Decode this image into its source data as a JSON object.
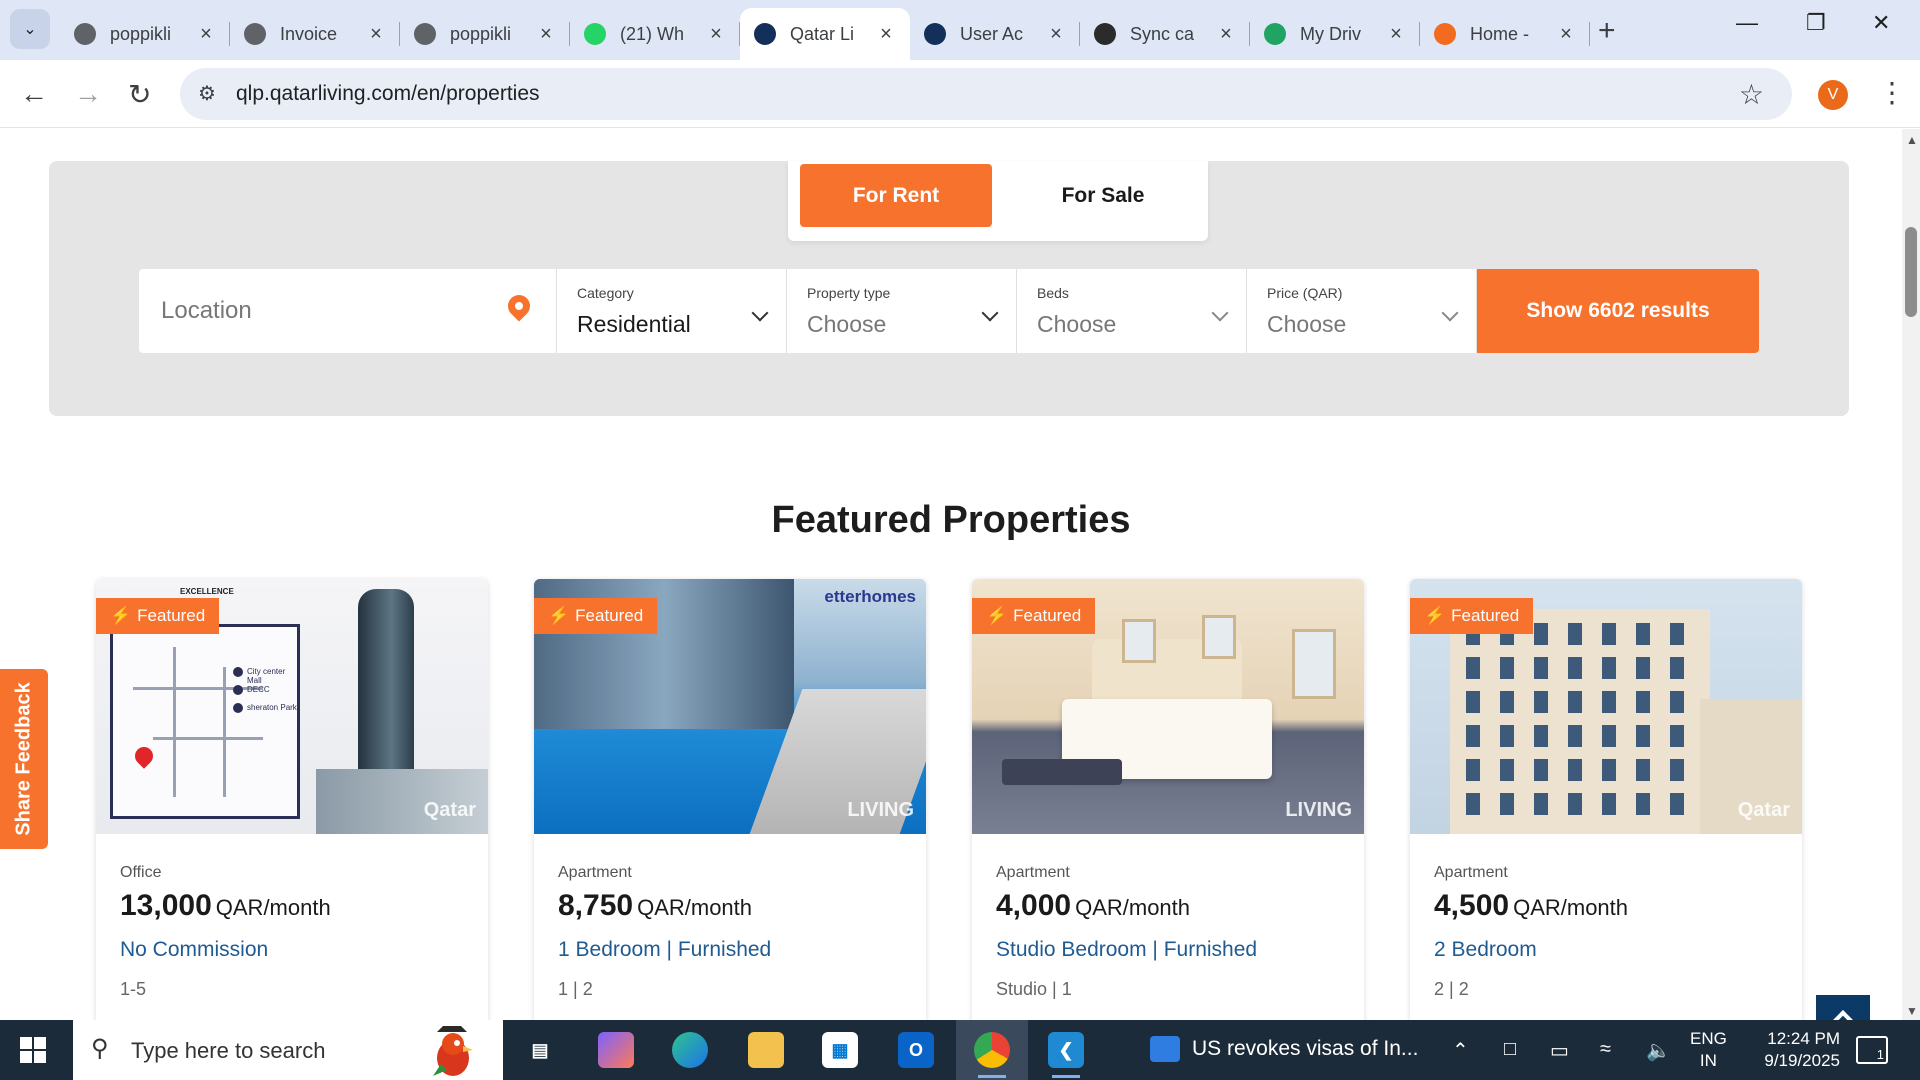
{
  "browser": {
    "tabs": [
      {
        "title": "poppikli",
        "favicon": "globe-icon",
        "active": false
      },
      {
        "title": "Invoice",
        "favicon": "globe-icon",
        "active": false
      },
      {
        "title": "poppikli",
        "favicon": "globe-icon",
        "active": false
      },
      {
        "title": "(21) Wh",
        "favicon": "whatsapp-icon",
        "active": false
      },
      {
        "title": "Qatar Li",
        "favicon": "qatarliving-icon",
        "active": true
      },
      {
        "title": "User Ac",
        "favicon": "qatarliving-icon",
        "active": false
      },
      {
        "title": "Sync ca",
        "favicon": "openai-icon",
        "active": false
      },
      {
        "title": "My Driv",
        "favicon": "google-drive-icon",
        "active": false
      },
      {
        "title": "Home -",
        "favicon": "orange-logo-icon",
        "active": false
      }
    ],
    "url": "qlp.qatarliving.com/en/properties",
    "profile_initial": "V"
  },
  "search": {
    "mode_tabs": {
      "rent": "For Rent",
      "sale": "For Sale",
      "active": "rent"
    },
    "location_placeholder": "Location",
    "category": {
      "label": "Category",
      "value": "Residential"
    },
    "property_type": {
      "label": "Property type",
      "value": "Choose"
    },
    "beds": {
      "label": "Beds",
      "value": "Choose"
    },
    "price": {
      "label": "Price (QAR)",
      "value": "Choose"
    },
    "submit_label": "Show 6602 results"
  },
  "featured": {
    "title": "Featured Properties",
    "badge_label": "Featured",
    "cards": [
      {
        "type": "Office",
        "price": "13,000",
        "unit": "QAR/month",
        "subtitle": "No Commission",
        "meta": "1-5"
      },
      {
        "type": "Apartment",
        "price": "8,750",
        "unit": "QAR/month",
        "subtitle": "1 Bedroom | Furnished",
        "meta": "1 | 2"
      },
      {
        "type": "Apartment",
        "price": "4,000",
        "unit": "QAR/month",
        "subtitle": "Studio Bedroom | Furnished",
        "meta": "Studio | 1"
      },
      {
        "type": "Apartment",
        "price": "4,500",
        "unit": "QAR/month",
        "subtitle": "2 Bedroom",
        "meta": "2 | 2"
      }
    ]
  },
  "image_text": {
    "map_legend": [
      "City center Mall",
      "DECC",
      "sheraton Park"
    ],
    "map_brand": "EXCELLENCE",
    "agency_watermark": "etterhomes",
    "watermark_qatar": "Qatar",
    "watermark_living": "LIVING"
  },
  "feedback_label": "Share Feedback",
  "taskbar": {
    "search_placeholder": "Type here to search",
    "news_text": "US revokes visas of In...",
    "lang": "ENG",
    "region": "IN",
    "time": "12:24 PM",
    "date": "9/19/2025",
    "notification_count": "1"
  },
  "colors": {
    "accent": "#f7722c",
    "link": "#1f5b92",
    "back_to_top": "#0c3a66"
  }
}
